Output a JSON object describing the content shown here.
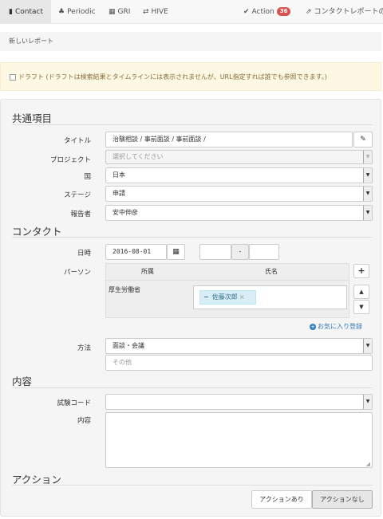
{
  "nav": {
    "contact": "Contact",
    "periodic": "Periodic",
    "gri": "GRI",
    "hive": "HIVE",
    "action": "Action",
    "action_count": "36",
    "contact_report": "コンタクトレポートの"
  },
  "subhead": "新しいレポート",
  "draft_notice": "ドラフト (ドラフトは検索結果とタイムラインには表示されませんが、URL指定すれば誰でも参照できます。)",
  "common": {
    "heading": "共通項目",
    "title_label": "タイトル",
    "title_value": "治験相談 / 事前面談 / 事前面談 /",
    "project_label": "プロジェクト",
    "project_placeholder": "選択してください",
    "country_label": "国",
    "country_value": "日本",
    "stage_label": "ステージ",
    "stage_value": "申請",
    "reporter_label": "報告者",
    "reporter_value": "安中伸彦"
  },
  "contact": {
    "heading": "コンタクト",
    "datetime_label": "日時",
    "date_value": "2016-08-01",
    "time_separator": "-",
    "person_label": "パーソン",
    "col_affiliation": "所属",
    "col_name": "氏名",
    "affiliation": "厚生労働省",
    "person_tag": "佐藤次郎",
    "favorites_link": "お気に入り登録",
    "method_label": "方法",
    "method_value": "面談・会議",
    "other_placeholder": "その他"
  },
  "content": {
    "heading": "内容",
    "test_code_label": "試験コード",
    "content_label": "内容"
  },
  "action": {
    "heading": "アクション",
    "with_action": "アクションあり",
    "no_action": "アクションなし"
  },
  "colors": {
    "badge": "#d9534f",
    "warning_bg": "#fcf8e3",
    "tag_bg": "#d9edf7",
    "link": "#337ab7"
  }
}
